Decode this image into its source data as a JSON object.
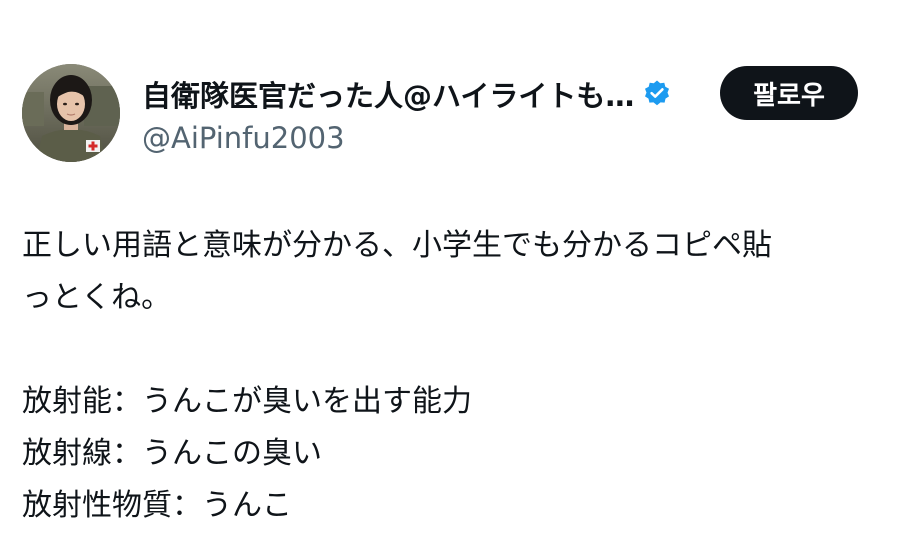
{
  "user": {
    "display_name": "自衛隊医官だった人@ハイライトも…",
    "handle": "@AiPinfu2003",
    "verified_icon": "verified-badge-icon",
    "verified_color": "#1d9bf0"
  },
  "follow_button": {
    "label": "팔로우",
    "background": "#0f1419",
    "text_color": "#ffffff"
  },
  "tweet": {
    "lines": [
      "正しい用語と意味が分かる、小学生でも分かるコピペ貼",
      "っとくね。",
      "",
      "放射能：うんこが臭いを出す能力",
      "放射線：うんこの臭い",
      "放射性物質：うんこ"
    ]
  }
}
